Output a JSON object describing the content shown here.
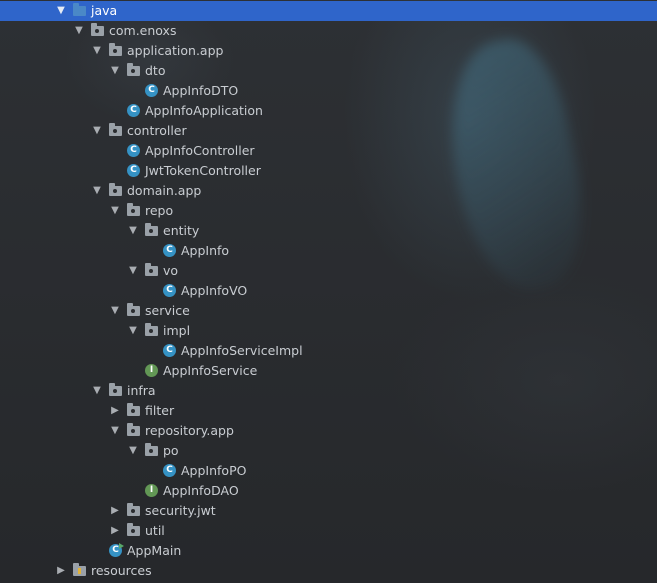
{
  "tree": [
    {
      "label": "java",
      "depth": 0,
      "arrow": "down",
      "icon": "folder-blue",
      "icon_name": "source-folder-icon",
      "selected": true
    },
    {
      "label": "com.enoxs",
      "depth": 1,
      "arrow": "down",
      "icon": "folder",
      "icon_name": "package-icon"
    },
    {
      "label": "application.app",
      "depth": 2,
      "arrow": "down",
      "icon": "folder",
      "icon_name": "package-icon"
    },
    {
      "label": "dto",
      "depth": 3,
      "arrow": "down",
      "icon": "folder",
      "icon_name": "package-icon"
    },
    {
      "label": "AppInfoDTO",
      "depth": 4,
      "arrow": "none",
      "icon": "class",
      "icon_name": "class-icon"
    },
    {
      "label": "AppInfoApplication",
      "depth": 3,
      "arrow": "none",
      "icon": "class",
      "icon_name": "class-icon"
    },
    {
      "label": "controller",
      "depth": 2,
      "arrow": "down",
      "icon": "folder",
      "icon_name": "package-icon"
    },
    {
      "label": "AppInfoController",
      "depth": 3,
      "arrow": "none",
      "icon": "class",
      "icon_name": "class-icon"
    },
    {
      "label": "JwtTokenController",
      "depth": 3,
      "arrow": "none",
      "icon": "class",
      "icon_name": "class-icon"
    },
    {
      "label": "domain.app",
      "depth": 2,
      "arrow": "down",
      "icon": "folder",
      "icon_name": "package-icon"
    },
    {
      "label": "repo",
      "depth": 3,
      "arrow": "down",
      "icon": "folder",
      "icon_name": "package-icon"
    },
    {
      "label": "entity",
      "depth": 4,
      "arrow": "down",
      "icon": "folder",
      "icon_name": "package-icon"
    },
    {
      "label": "AppInfo",
      "depth": 5,
      "arrow": "none",
      "icon": "class",
      "icon_name": "class-icon"
    },
    {
      "label": "vo",
      "depth": 4,
      "arrow": "down",
      "icon": "folder",
      "icon_name": "package-icon"
    },
    {
      "label": "AppInfoVO",
      "depth": 5,
      "arrow": "none",
      "icon": "class",
      "icon_name": "class-icon"
    },
    {
      "label": "service",
      "depth": 3,
      "arrow": "down",
      "icon": "folder",
      "icon_name": "package-icon"
    },
    {
      "label": "impl",
      "depth": 4,
      "arrow": "down",
      "icon": "folder",
      "icon_name": "package-icon"
    },
    {
      "label": "AppInfoServiceImpl",
      "depth": 5,
      "arrow": "none",
      "icon": "class",
      "icon_name": "class-icon"
    },
    {
      "label": "AppInfoService",
      "depth": 4,
      "arrow": "none",
      "icon": "interface",
      "icon_name": "interface-icon"
    },
    {
      "label": "infra",
      "depth": 2,
      "arrow": "down",
      "icon": "folder",
      "icon_name": "package-icon"
    },
    {
      "label": "filter",
      "depth": 3,
      "arrow": "right",
      "icon": "folder",
      "icon_name": "package-icon"
    },
    {
      "label": "repository.app",
      "depth": 3,
      "arrow": "down",
      "icon": "folder",
      "icon_name": "package-icon"
    },
    {
      "label": "po",
      "depth": 4,
      "arrow": "down",
      "icon": "folder",
      "icon_name": "package-icon"
    },
    {
      "label": "AppInfoPO",
      "depth": 5,
      "arrow": "none",
      "icon": "class",
      "icon_name": "class-icon"
    },
    {
      "label": "AppInfoDAO",
      "depth": 4,
      "arrow": "none",
      "icon": "interface",
      "icon_name": "interface-icon"
    },
    {
      "label": "security.jwt",
      "depth": 3,
      "arrow": "right",
      "icon": "folder",
      "icon_name": "package-icon"
    },
    {
      "label": "util",
      "depth": 3,
      "arrow": "right",
      "icon": "folder",
      "icon_name": "package-icon"
    },
    {
      "label": "AppMain",
      "depth": 2,
      "arrow": "none",
      "icon": "main",
      "icon_name": "main-class-icon"
    },
    {
      "label": "resources",
      "depth": 0,
      "arrow": "right",
      "icon": "folder-res",
      "icon_name": "resources-folder-icon"
    }
  ],
  "icon_glyphs": {
    "class": "C",
    "interface": "I",
    "main": "C"
  },
  "colors": {
    "selection": "#2f65ca",
    "class_icon": "#3592c4",
    "interface_icon": "#629755",
    "source_folder": "#4a88c7",
    "text": "#c9cdd2"
  }
}
